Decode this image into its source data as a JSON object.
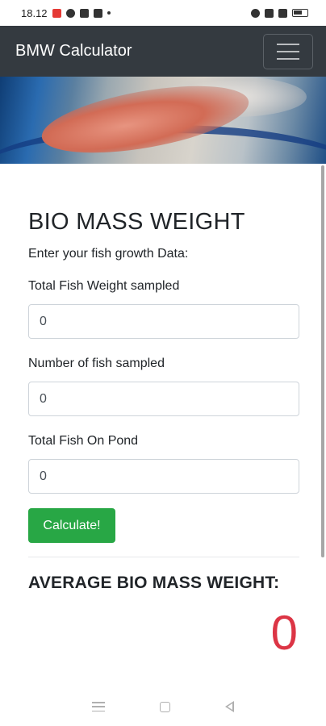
{
  "status_bar": {
    "time": "18.12"
  },
  "navbar": {
    "brand": "BMW Calculator"
  },
  "form": {
    "title": "BIO MASS WEIGHT",
    "subtitle": "Enter your fish growth Data:",
    "fields": [
      {
        "label": "Total Fish Weight sampled",
        "value": "0"
      },
      {
        "label": "Number of fish sampled",
        "value": "0"
      },
      {
        "label": "Total Fish On Pond",
        "value": "0"
      }
    ],
    "calculate_label": "Calculate!"
  },
  "result": {
    "title": "AVERAGE BIO MASS WEIGHT:",
    "value": "0"
  },
  "colors": {
    "navbar": "#343a40",
    "button": "#28a745",
    "result": "#dc3545"
  },
  "icons": [
    "hamburger-menu-icon",
    "android-menu-icon",
    "android-home-icon",
    "android-back-icon"
  ]
}
